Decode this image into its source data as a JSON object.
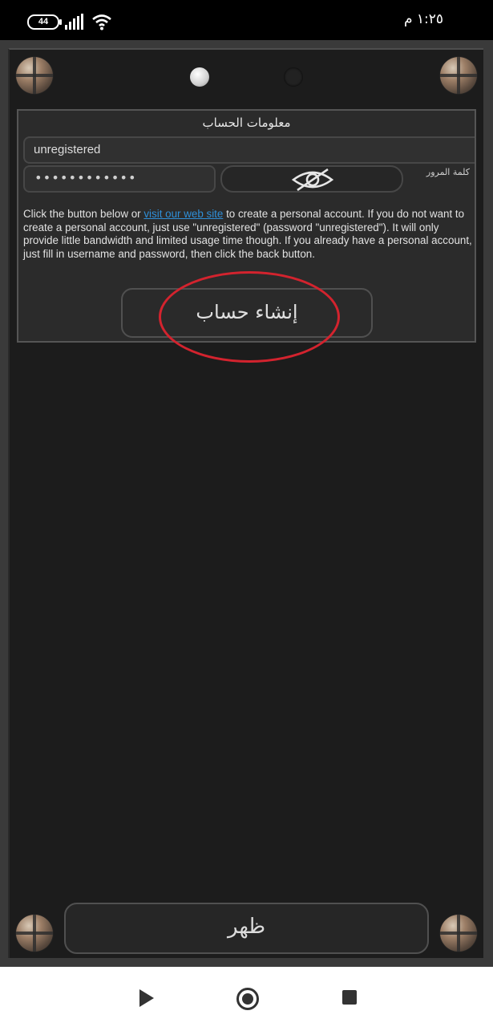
{
  "status_bar": {
    "battery": "44",
    "time": "١:٢٥ م",
    "icons": [
      "battery-icon",
      "signal-icon",
      "wifi-icon"
    ]
  },
  "pager": {
    "pages": 2,
    "current": 1
  },
  "account": {
    "title": "معلومات الحساب",
    "username_value": "unregistered",
    "password_value": "••••••••••••",
    "password_label": "كلمة المرور",
    "toggle_icon": "eye-off-icon",
    "info_before_link": "Click the button below or ",
    "info_link": "visit our web site",
    "info_after_link": " to create a personal account. If you do not want to create a personal account, just use \"unregistered\" (password \"unregistered\"). It will only provide little bandwidth and limited usage time though. If you already have a personal account, just fill in username and password, then click the back button.",
    "create_button": "إنشاء حساب"
  },
  "footer": {
    "back_button": "ظهر"
  },
  "colors": {
    "link": "#2f8fd8",
    "highlight": "#d3232e",
    "panel": "#1c1c1c"
  },
  "navbar": {
    "icons": [
      "nav-back-icon",
      "nav-home-icon",
      "nav-recents-icon"
    ]
  }
}
